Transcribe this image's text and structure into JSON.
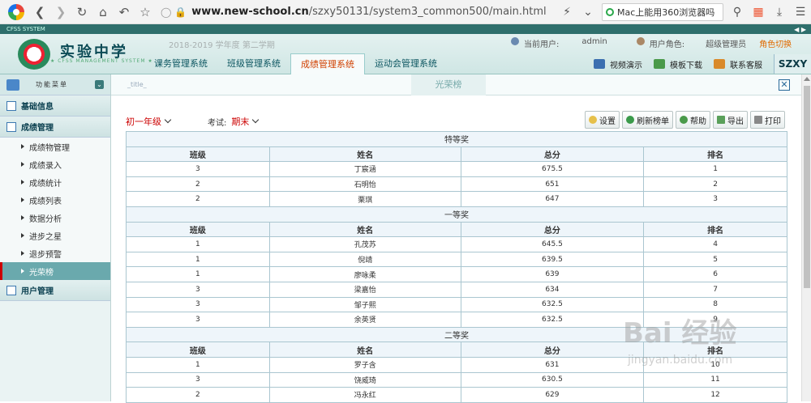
{
  "browser": {
    "url_domain": "www.new-school.cn",
    "url_path": "/szxy50131/system3_common500/main.html",
    "search_text": "Mac上能用360浏览器吗"
  },
  "header": {
    "strip_text": "CFSS SYSTEM",
    "school_name": "实验中学",
    "school_sub": "★ CFSS MANAGEMENT SYSTEM ★",
    "term": "2018-2019 学年度 第二学期",
    "current_user_label": "当前用户:",
    "current_user": "admin",
    "role_label": "用户角色:",
    "role": "超级管理员",
    "role_switch": "角色切换",
    "modules": [
      "课务管理系统",
      "班级管理系统",
      "成绩管理系统",
      "运动会管理系统"
    ],
    "tools": [
      "视频演示",
      "模板下载",
      "联系客服"
    ],
    "brand": "SZXY"
  },
  "sidebar": {
    "title": "功能菜单",
    "groups": [
      {
        "label": "基础信息"
      },
      {
        "label": "成绩管理"
      },
      {
        "label": "用户管理"
      }
    ],
    "items": [
      "成绩物管理",
      "成绩录入",
      "成绩统计",
      "成绩列表",
      "数据分析",
      "进步之星",
      "退步预警",
      "光荣榜"
    ]
  },
  "content": {
    "title_placeholder": "_title_",
    "tab": "光荣榜",
    "grade": "初一年级",
    "exam_label": "考试:",
    "exam": "期末",
    "buttons": [
      "设置",
      "刷新榜单",
      "帮助",
      "导出",
      "打印"
    ]
  },
  "table": {
    "columns": [
      "班级",
      "姓名",
      "总分",
      "排名"
    ],
    "sections": [
      {
        "title": "特等奖",
        "rows": [
          [
            "3",
            "丁宸涵",
            "675.5",
            "1"
          ],
          [
            "2",
            "石明怡",
            "651",
            "2"
          ],
          [
            "2",
            "栗琪",
            "647",
            "3"
          ]
        ]
      },
      {
        "title": "一等奖",
        "rows": [
          [
            "1",
            "孔茂苏",
            "645.5",
            "4"
          ],
          [
            "1",
            "倪靖",
            "639.5",
            "5"
          ],
          [
            "1",
            "廖咏柔",
            "639",
            "6"
          ],
          [
            "3",
            "梁嘉怡",
            "634",
            "7"
          ],
          [
            "3",
            "邹子熙",
            "632.5",
            "8"
          ],
          [
            "3",
            "余英贤",
            "632.5",
            "9"
          ]
        ]
      },
      {
        "title": "二等奖",
        "rows": [
          [
            "1",
            "罗子含",
            "631",
            "10"
          ],
          [
            "3",
            "饶威琦",
            "630.5",
            "11"
          ],
          [
            "2",
            "冯永红",
            "629",
            "12"
          ]
        ]
      }
    ]
  },
  "watermark": {
    "line1": "Bai 经验",
    "line2": "jingyan.baidu.com"
  }
}
